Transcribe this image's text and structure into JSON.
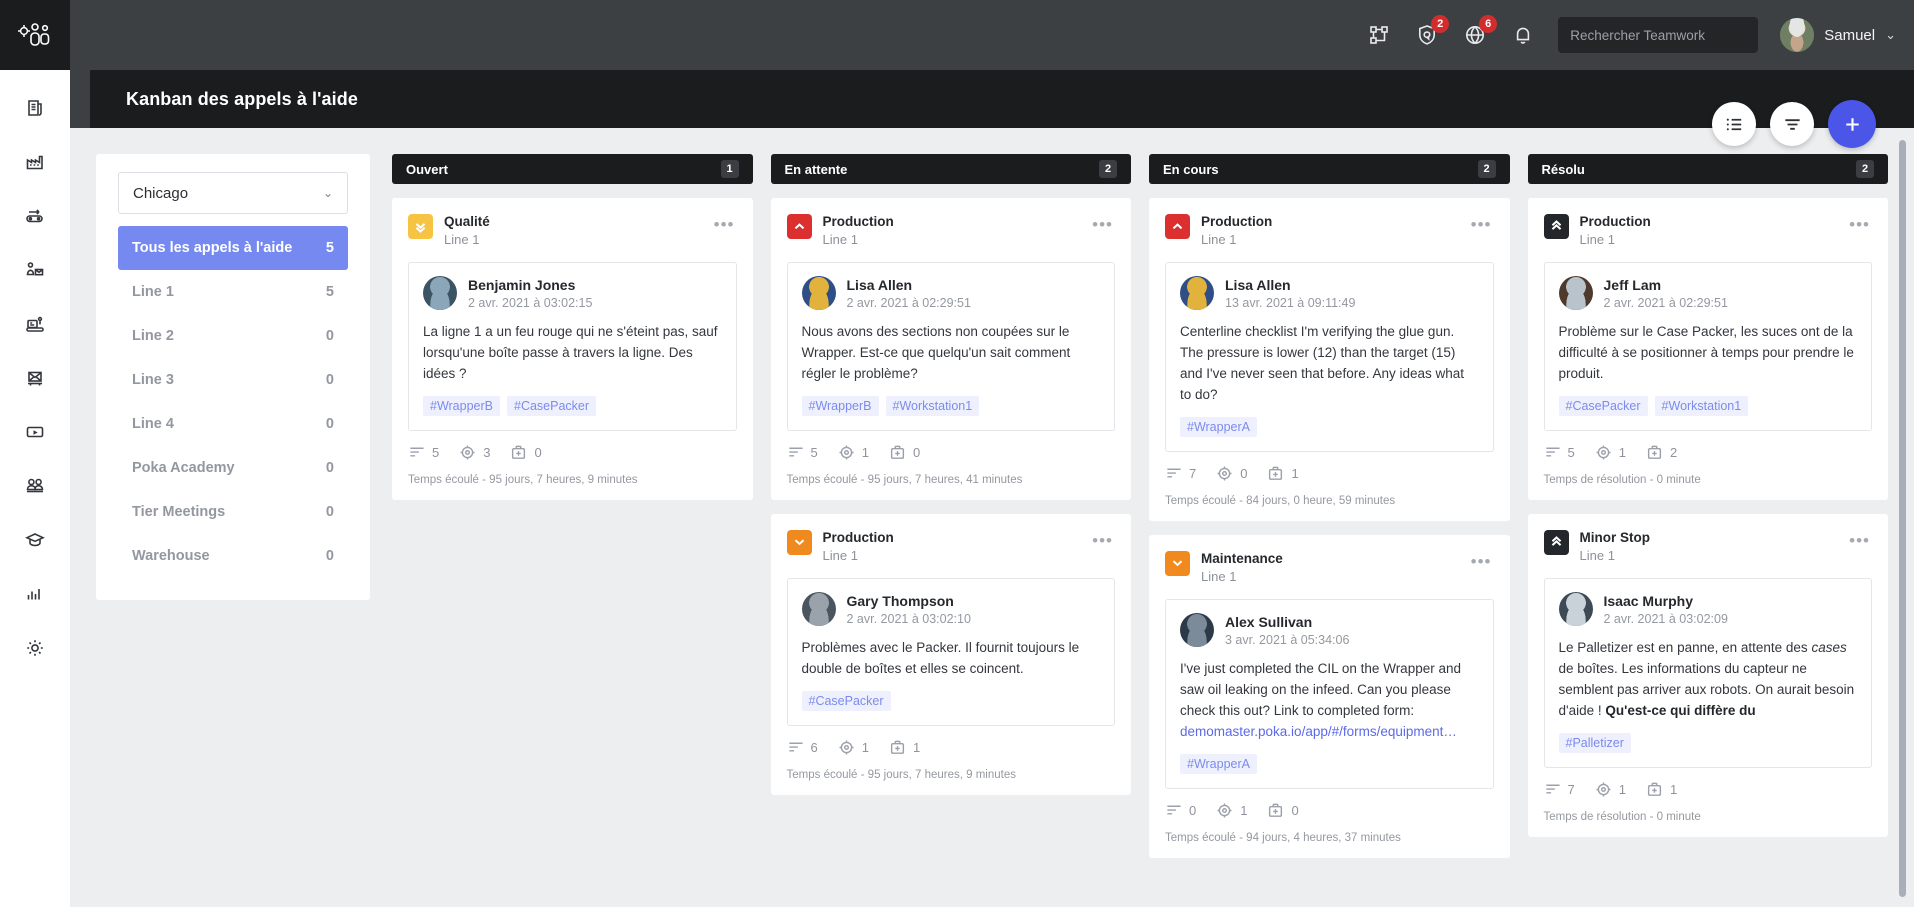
{
  "app": {
    "logo_icon": "teamwork-gear-people-logo",
    "rail_items": [
      {
        "name": "sidebar-item-feed",
        "icon": "document-feed-icon"
      },
      {
        "name": "sidebar-item-factory",
        "icon": "factory-icon"
      },
      {
        "name": "sidebar-item-conveyor",
        "icon": "conveyor-arrow-icon"
      },
      {
        "name": "sidebar-item-requests",
        "icon": "person-envelope-icon"
      },
      {
        "name": "sidebar-item-machines",
        "icon": "machine-station-icon"
      },
      {
        "name": "sidebar-item-broadcast",
        "icon": "broadcast-envelope-icon"
      },
      {
        "name": "sidebar-item-video",
        "icon": "video-play-icon"
      },
      {
        "name": "sidebar-item-teams",
        "icon": "users-group-icon"
      },
      {
        "name": "sidebar-item-academy",
        "icon": "graduation-cap-icon"
      },
      {
        "name": "sidebar-item-analytics",
        "icon": "bar-chart-icon"
      },
      {
        "name": "sidebar-item-settings",
        "icon": "gear-icon"
      }
    ]
  },
  "topbar": {
    "icons": [
      {
        "name": "scan-frame-icon",
        "badge": ""
      },
      {
        "name": "shield-icon",
        "badge": "2"
      },
      {
        "name": "globe-help-icon",
        "badge": "6"
      },
      {
        "name": "bell-notifications-icon",
        "badge": ""
      }
    ],
    "search": {
      "placeholder": "Rechercher Teamwork",
      "value": "",
      "icon": "search-icon"
    },
    "user": {
      "name": "Samuel",
      "caret": "⌄",
      "avatar": "user-avatar"
    }
  },
  "page": {
    "title": "Kanban des appels à l'aide"
  },
  "actions": {
    "list_view": {
      "name": "list-view-button",
      "icon": "list-icon"
    },
    "filter": {
      "name": "filter-button",
      "icon": "filter-icon"
    },
    "add": {
      "name": "add-button",
      "icon": "plus-icon",
      "color": "#4b56e8"
    }
  },
  "filters": {
    "location": {
      "value": "Chicago",
      "chevron": "⌄"
    },
    "rows": [
      {
        "label": "Tous les appels à l'aide",
        "count": "5",
        "active": true
      },
      {
        "label": "Line 1",
        "count": "5",
        "active": false
      },
      {
        "label": "Line 2",
        "count": "0",
        "active": false
      },
      {
        "label": "Line 3",
        "count": "0",
        "active": false
      },
      {
        "label": "Line 4",
        "count": "0",
        "active": false
      },
      {
        "label": "Poka Academy",
        "count": "0",
        "active": false
      },
      {
        "label": "Tier Meetings",
        "count": "0",
        "active": false
      },
      {
        "label": "Warehouse",
        "count": "0",
        "active": false
      }
    ]
  },
  "board": {
    "columns": [
      {
        "title": "Ouvert",
        "count": "1",
        "cards": [
          {
            "priority": {
              "color": "#f6c343",
              "icon": "double-chevron-down-icon"
            },
            "category": "Qualité",
            "line": "Line 1",
            "menu": "•••",
            "author": "Benjamin Jones",
            "date": "2 avr. 2021 à 03:02:15",
            "body": "La ligne 1 a un feu rouge qui ne s'éteint pas, sauf lorsqu'une boîte passe à travers la ligne. Des idées ?",
            "tags": [
              "#WrapperB",
              "#CasePacker"
            ],
            "stats": [
              {
                "icon": "comments-icon",
                "value": "5"
              },
              {
                "icon": "target-icon",
                "value": "3"
              },
              {
                "icon": "first-aid-kit-icon",
                "value": "0"
              }
            ],
            "elapsed": "Temps écoulé - 95 jours, 7 heures, 9 minutes",
            "avatar_colors": [
              "#8aa6b8",
              "#3c5364"
            ]
          }
        ]
      },
      {
        "title": "En attente",
        "count": "2",
        "cards": [
          {
            "priority": {
              "color": "#dc3030",
              "icon": "chevron-up-icon"
            },
            "category": "Production",
            "line": "Line 1",
            "menu": "•••",
            "author": "Lisa Allen",
            "date": "2 avr. 2021 à 02:29:51",
            "body": "Nous avons des sections non coupées sur le Wrapper. Est-ce que quelqu'un sait comment régler le problème?",
            "tags": [
              "#WrapperB",
              "#Workstation1"
            ],
            "stats": [
              {
                "icon": "comments-icon",
                "value": "5"
              },
              {
                "icon": "target-icon",
                "value": "1"
              },
              {
                "icon": "first-aid-kit-icon",
                "value": "0"
              }
            ],
            "elapsed": "Temps écoulé - 95 jours, 7 heures, 41 minutes",
            "avatar_colors": [
              "#e2b33c",
              "#2f4d86"
            ]
          },
          {
            "priority": {
              "color": "#f08a1e",
              "icon": "chevron-down-icon"
            },
            "category": "Production",
            "line": "Line 1",
            "menu": "•••",
            "author": "Gary Thompson",
            "date": "2 avr. 2021 à 03:02:10",
            "body": "Problèmes avec le Packer. Il fournit toujours le double de boîtes et elles se coincent.",
            "tags": [
              "#CasePacker"
            ],
            "stats": [
              {
                "icon": "comments-icon",
                "value": "6"
              },
              {
                "icon": "target-icon",
                "value": "1"
              },
              {
                "icon": "first-aid-kit-icon",
                "value": "1"
              }
            ],
            "elapsed": "Temps écoulé - 95 jours, 7 heures, 9 minutes",
            "avatar_colors": [
              "#9aa3ab",
              "#4b5560"
            ]
          }
        ]
      },
      {
        "title": "En cours",
        "count": "2",
        "cards": [
          {
            "priority": {
              "color": "#dc3030",
              "icon": "chevron-up-icon"
            },
            "category": "Production",
            "line": "Line 1",
            "menu": "•••",
            "author": "Lisa Allen",
            "date": "13 avr. 2021 à 09:11:49",
            "body": "Centerline checklist I'm verifying the glue gun. The pressure is lower (12) than the target (15) and I've never seen that before. Any ideas what to do?",
            "tags": [
              "#WrapperA"
            ],
            "stats": [
              {
                "icon": "comments-icon",
                "value": "7"
              },
              {
                "icon": "target-icon",
                "value": "0"
              },
              {
                "icon": "first-aid-kit-icon",
                "value": "1"
              }
            ],
            "elapsed": "Temps écoulé - 84 jours, 0 heure, 59 minutes",
            "avatar_colors": [
              "#e2b33c",
              "#2f4d86"
            ]
          },
          {
            "priority": {
              "color": "#f08a1e",
              "icon": "chevron-down-icon"
            },
            "category": "Maintenance",
            "line": "Line 1",
            "menu": "•••",
            "author": "Alex Sullivan",
            "date": "3 avr. 2021 à 05:34:06",
            "body_pre": "I've just completed the CIL on the Wrapper and saw oil leaking on the infeed. Can you please check this out? Link to completed form: ",
            "body_link": "demomaster.poka.io/app/#/forms/equipment…",
            "tags": [
              "#WrapperA"
            ],
            "stats": [
              {
                "icon": "comments-icon",
                "value": "0"
              },
              {
                "icon": "target-icon",
                "value": "1"
              },
              {
                "icon": "first-aid-kit-icon",
                "value": "0"
              }
            ],
            "elapsed": "Temps écoulé - 94 jours, 4 heures, 37 minutes",
            "avatar_colors": [
              "#7b8b99",
              "#2c3a48"
            ]
          }
        ]
      },
      {
        "title": "Résolu",
        "count": "2",
        "cards": [
          {
            "priority": {
              "color": "#23262a",
              "icon": "double-chevron-up-icon"
            },
            "category": "Production",
            "line": "Line 1",
            "menu": "•••",
            "author": "Jeff Lam",
            "date": "2 avr. 2021 à 02:29:51",
            "body": "Problème sur le Case Packer, les suces ont de la difficulté à se positionner à temps pour prendre le produit.",
            "tags": [
              "#CasePacker",
              "#Workstation1"
            ],
            "stats": [
              {
                "icon": "comments-icon",
                "value": "5"
              },
              {
                "icon": "target-icon",
                "value": "1"
              },
              {
                "icon": "first-aid-kit-icon",
                "value": "2"
              }
            ],
            "elapsed": "Temps de résolution - 0 minute",
            "avatar_colors": [
              "#b9c3cb",
              "#4d3a2c"
            ]
          },
          {
            "priority": {
              "color": "#23262a",
              "icon": "double-chevron-up-icon"
            },
            "category": "Minor Stop",
            "line": "Line 1",
            "menu": "•••",
            "author": "Isaac Murphy",
            "date": "2 avr. 2021 à 03:02:09",
            "body_pre": "Le Palletizer est en panne, en attente des ",
            "body_em": "cases",
            "body_mid": " de boîtes. Les informations du capteur ne semblent pas arriver aux robots. On aurait besoin d'aide ! ",
            "body_strong": "Qu'est-ce qui diffère du",
            "tags": [
              "#Palletizer"
            ],
            "stats": [
              {
                "icon": "comments-icon",
                "value": "7"
              },
              {
                "icon": "target-icon",
                "value": "1"
              },
              {
                "icon": "first-aid-kit-icon",
                "value": "1"
              }
            ],
            "elapsed": "Temps de résolution - 0 minute",
            "avatar_colors": [
              "#c9d2d8",
              "#3d4a55"
            ]
          }
        ]
      }
    ]
  },
  "scrollbar": {
    "name": "board-vertical-scrollbar"
  }
}
